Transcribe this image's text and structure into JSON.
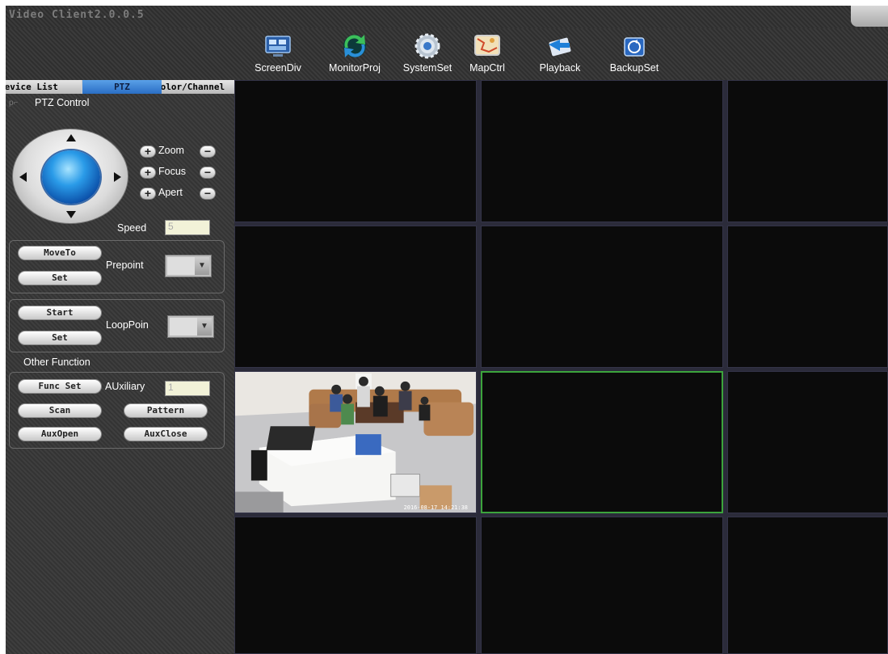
{
  "app": {
    "title": "Video Client2.0.0.5"
  },
  "toolbar": [
    {
      "label": "ScreenDiv",
      "icon": "screen-division-icon"
    },
    {
      "label": "MonitorProj",
      "icon": "monitor-project-icon"
    },
    {
      "label": "SystemSet",
      "icon": "system-settings-icon"
    },
    {
      "label": "MapCtrl",
      "icon": "map-control-icon"
    },
    {
      "label": "Playback",
      "icon": "playback-icon"
    },
    {
      "label": "BackupSet",
      "icon": "backup-settings-icon"
    }
  ],
  "tabs": {
    "device": "Device List",
    "ptz": "PTZ",
    "color": "Color/Channel"
  },
  "ptz": {
    "header": "PTZ Control",
    "zoom": "Zoom",
    "focus": "Focus",
    "apert": "Apert",
    "speed_label": "Speed",
    "speed_value": "5",
    "moveto": "MoveTo",
    "set1": "Set",
    "prepoint": "Prepoint",
    "start": "Start",
    "set2": "Set",
    "looppoint": "LoopPoin",
    "other_function": "Other Function",
    "func_set": "Func Set",
    "auxiliary": "AUxiliary",
    "aux_value": "1",
    "scan": "Scan",
    "pattern": "Pattern",
    "aux_open": "AuxOpen",
    "aux_close": "AuxClose"
  },
  "video": {
    "rows": 4,
    "cols": 3,
    "feed_cell": 6,
    "active_cell": 7,
    "feed_timestamp": "2016-08-17 14:21:38"
  },
  "colors": {
    "active_border": "#3ca43c",
    "tab_active": "#2a6ec4"
  }
}
